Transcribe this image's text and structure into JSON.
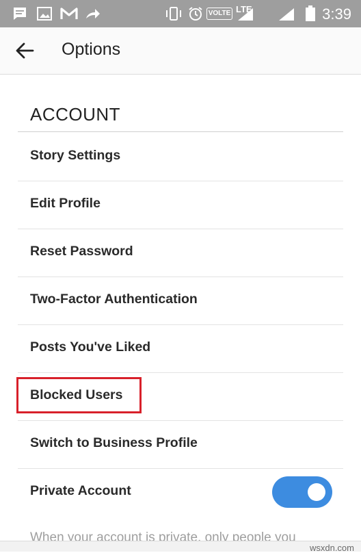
{
  "status_bar": {
    "time": "3:39",
    "network": "LTE",
    "volte": "VOLTE",
    "icons": [
      "message-icon",
      "image-icon",
      "gmail-icon",
      "forward-icon",
      "vibrate-icon",
      "alarm-icon",
      "signal-icon",
      "battery-icon"
    ]
  },
  "app_bar": {
    "title": "Options",
    "back_icon": "arrow-back-icon"
  },
  "section": {
    "header": "ACCOUNT"
  },
  "options": [
    {
      "label": "Story Settings"
    },
    {
      "label": "Edit Profile"
    },
    {
      "label": "Reset Password"
    },
    {
      "label": "Two-Factor Authentication"
    },
    {
      "label": "Posts You've Liked"
    },
    {
      "label": "Blocked Users"
    },
    {
      "label": "Switch to Business Profile"
    },
    {
      "label": "Private Account"
    }
  ],
  "private_account": {
    "toggle_on": true,
    "helper_text": "When your account is private, only people you"
  },
  "highlight": {
    "target": "Blocked Users",
    "color": "#d8202a"
  },
  "colors": {
    "accent": "#3d8ce0",
    "status_bar": "#9e9e9e"
  },
  "watermark": "wsxdn.com"
}
